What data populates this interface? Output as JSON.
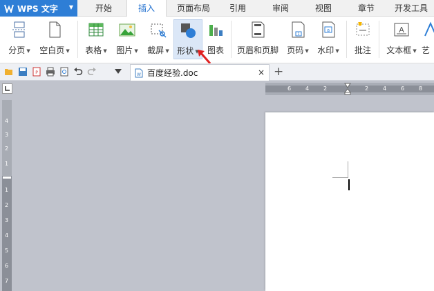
{
  "menubar": {
    "app_title": "WPS 文字",
    "tabs": [
      {
        "label": "开始"
      },
      {
        "label": "插入",
        "active": true
      },
      {
        "label": "页面布局"
      },
      {
        "label": "引用"
      },
      {
        "label": "审阅"
      },
      {
        "label": "视图"
      },
      {
        "label": "章节"
      },
      {
        "label": "开发工具"
      }
    ]
  },
  "ribbon": {
    "items": [
      {
        "label": "分页",
        "icon": "page-break-icon"
      },
      {
        "label": "空白页",
        "icon": "blank-page-icon"
      },
      {
        "label": "表格",
        "icon": "table-icon"
      },
      {
        "label": "图片",
        "icon": "picture-icon"
      },
      {
        "label": "截屏",
        "icon": "screenshot-icon"
      },
      {
        "label": "形状",
        "icon": "shapes-icon"
      },
      {
        "label": "图表",
        "icon": "chart-icon"
      },
      {
        "label": "页眉和页脚",
        "icon": "header-footer-icon"
      },
      {
        "label": "页码",
        "icon": "page-number-icon"
      },
      {
        "label": "水印",
        "icon": "watermark-icon"
      },
      {
        "label": "批注",
        "icon": "comment-icon"
      },
      {
        "label": "文本框",
        "icon": "textbox-icon"
      },
      {
        "label": "艺",
        "icon": "wordart-icon"
      }
    ]
  },
  "quickbar": {
    "doc_tab": {
      "name": "百度经验.doc",
      "close": "×"
    },
    "new_tab": "+"
  },
  "ruler": {
    "h_ticks": [
      "6",
      "4",
      "2",
      "2",
      "4",
      "6",
      "8"
    ],
    "v_ticks": [
      "4",
      "3",
      "2",
      "1",
      "1",
      "2",
      "3",
      "4",
      "5",
      "6",
      "7"
    ]
  },
  "colors": {
    "accent": "#2e7ed6",
    "highlight": "#dbe7f7",
    "workspace": "#c0c3cc",
    "arrow": "#e02020"
  }
}
